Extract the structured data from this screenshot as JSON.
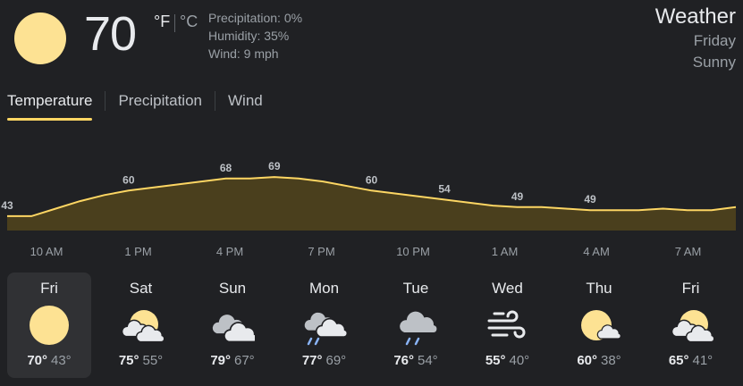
{
  "current": {
    "temp": "70",
    "unit_f": "°F",
    "unit_c": "°C",
    "icon": "sun-icon",
    "precipitation": "Precipitation: 0%",
    "humidity": "Humidity: 35%",
    "wind": "Wind: 9 mph"
  },
  "header": {
    "title": "Weather",
    "day": "Friday",
    "condition": "Sunny"
  },
  "tabs": [
    {
      "label": "Temperature",
      "active": true
    },
    {
      "label": "Precipitation",
      "active": false
    },
    {
      "label": "Wind",
      "active": false
    }
  ],
  "colors": {
    "accent": "#fdd663",
    "sun": "#fde293",
    "fill": "#4a3f1d",
    "cloud": "#e8eaed"
  },
  "chart_data": {
    "type": "area",
    "series": [
      {
        "values": [
          43,
          43,
          48,
          53,
          57,
          60,
          62,
          64,
          66,
          68,
          68,
          69,
          68,
          66,
          63,
          60,
          58,
          56,
          54,
          52,
          50,
          49,
          49,
          48,
          47,
          47,
          47,
          48,
          47,
          47,
          49
        ]
      }
    ],
    "value_labels": [
      {
        "value": "43",
        "index": 0
      },
      {
        "value": "60",
        "index": 5
      },
      {
        "value": "68",
        "index": 9
      },
      {
        "value": "69",
        "index": 11
      },
      {
        "value": "60",
        "index": 15
      },
      {
        "value": "54",
        "index": 18
      },
      {
        "value": "49",
        "index": 21
      },
      {
        "value": "49",
        "index": 24
      }
    ],
    "x_ticks": [
      "10 AM",
      "1 PM",
      "4 PM",
      "7 PM",
      "10 PM",
      "1 AM",
      "4 AM",
      "7 AM"
    ]
  },
  "forecast": [
    {
      "day": "Fri",
      "hi": "70°",
      "lo": "43°",
      "icon": "sun-icon",
      "selected": true
    },
    {
      "day": "Sat",
      "hi": "75°",
      "lo": "55°",
      "icon": "partly-cloudy-icon"
    },
    {
      "day": "Sun",
      "hi": "79°",
      "lo": "67°",
      "icon": "cloudy-icon"
    },
    {
      "day": "Mon",
      "hi": "77°",
      "lo": "69°",
      "icon": "rain-cloud-icon"
    },
    {
      "day": "Tue",
      "hi": "76°",
      "lo": "54°",
      "icon": "showers-icon"
    },
    {
      "day": "Wed",
      "hi": "55°",
      "lo": "40°",
      "icon": "wind-icon"
    },
    {
      "day": "Thu",
      "hi": "60°",
      "lo": "38°",
      "icon": "mostly-sunny-icon"
    },
    {
      "day": "Fri",
      "hi": "65°",
      "lo": "41°",
      "icon": "partly-cloudy-icon"
    }
  ]
}
